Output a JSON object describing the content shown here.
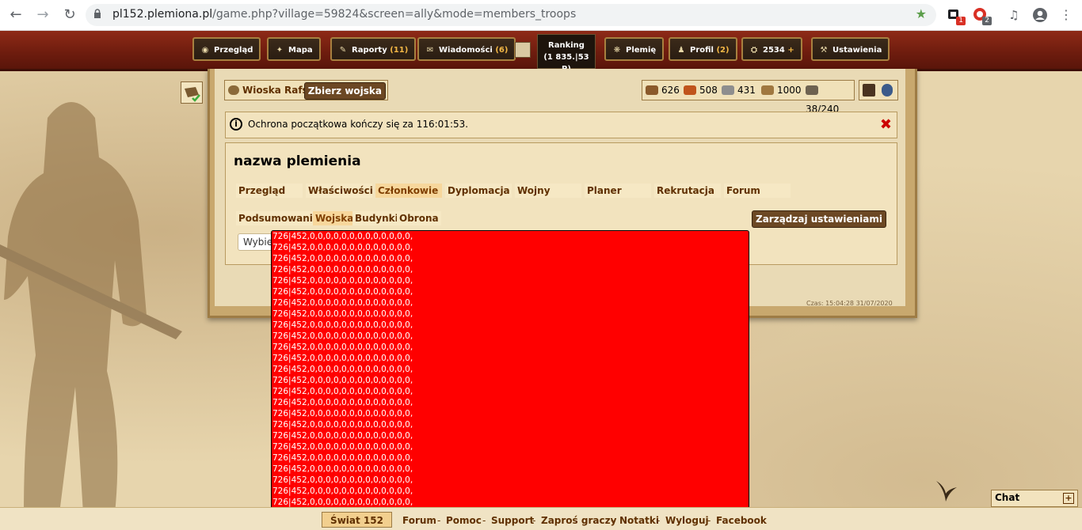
{
  "browser": {
    "url_host": "pl152.plemiona.pl",
    "url_path": "/game.php?village=59824&screen=ally&mode=members_troops",
    "ext_badge_1": "1",
    "ext_badge_2": "2"
  },
  "menu": {
    "items": [
      {
        "label": "Przegląd",
        "count": "",
        "icon": "eye-icon"
      },
      {
        "label": "Mapa",
        "count": "",
        "icon": "compass-icon"
      },
      {
        "label": "Raporty",
        "count": "(11)",
        "icon": "scroll-icon"
      },
      {
        "label": "Wiadomości",
        "count": "(6)",
        "icon": "envelope-icon"
      },
      {
        "label": "Plemię",
        "count": "",
        "icon": "tribe-icon"
      },
      {
        "label": "Profil",
        "count": "(2)",
        "icon": "profile-icon"
      },
      {
        "label": "2534",
        "count": "+",
        "icon": "premium-points-icon"
      },
      {
        "label": "Ustawienia",
        "count": "",
        "icon": "settings-icon"
      }
    ],
    "ranking_title": "Ranking",
    "ranking_value": "(1 835.|53 P)"
  },
  "village": {
    "name": "Wioska Rafsaf",
    "gather_label": "Zbierz wojska"
  },
  "resources": {
    "wood": "626",
    "clay": "508",
    "iron": "431",
    "storage": "1000",
    "population": "38/240"
  },
  "notice": {
    "text": "Ochrona początkowa kończy się za 116:01:53.",
    "close": "✖"
  },
  "tribe": {
    "title": "nazwa plemienia",
    "tabs": [
      "Przegląd",
      "Właściwości",
      "Członkowie",
      "Dyplomacja",
      "Wojny",
      "Planer",
      "Rekrutacja",
      "Forum"
    ],
    "active_tab": "Członkowie",
    "subtabs": [
      "Podsumowanie",
      "Wojska",
      "Budynki",
      "Obrona"
    ],
    "active_subtab": "Wojska",
    "manage_label": "Zarządzaj ustawieniami",
    "select_placeholder": "Wybierz"
  },
  "server_time": "Czas: 15:04:28 31/07/2020",
  "dump": {
    "line": "726|452,0,0,0,0,0,0,0,0,0,0,0,0,0,",
    "count": 25,
    "bg_color": "#ff0000"
  },
  "footer": {
    "world": "Świat 152",
    "links": [
      "Forum",
      "Pomoc",
      "Support",
      "Zaproś graczy",
      "Notatki",
      "Wyloguj",
      "Facebook"
    ],
    "separator": "-"
  },
  "chat": {
    "label": "Chat",
    "toggle": "+"
  }
}
